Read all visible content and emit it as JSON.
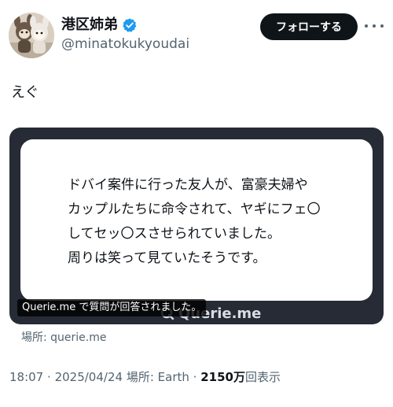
{
  "author": {
    "display_name": "港区姉弟",
    "handle": "@minatokukyoudai",
    "verified_icon": "verified-badge-icon",
    "verified_color": "#1d9bf0"
  },
  "follow_button_label": "フォローする",
  "more_icon": "more-horizontal-icon",
  "tweet_text": "えぐ",
  "card": {
    "lines": [
      "ドバイ案件に行った友人が、富豪夫婦や",
      "カップルたちに命令されて、ヤギにフェ〇",
      "してセッ〇スさせられていました。",
      "周りは笑って見ていたそうです。"
    ],
    "brand": "Querie.me",
    "caption": "Querie.me で質問が回答されました。",
    "source_label": "場所: querie.me",
    "background_color": "#262b35"
  },
  "meta": {
    "time": "18:07",
    "separator": "·",
    "date": "2025/04/24",
    "location": "場所: Earth",
    "views_count": "2150",
    "views_unit": "万",
    "views_label": "回表示"
  }
}
